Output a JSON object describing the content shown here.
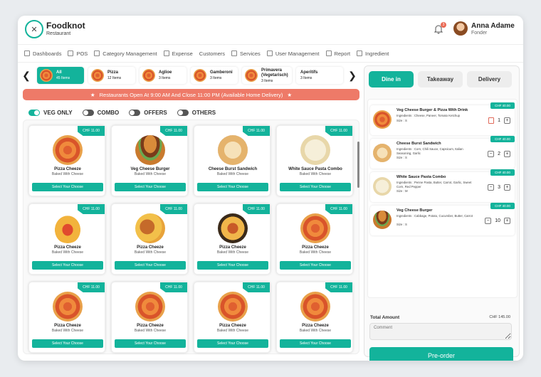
{
  "brand": {
    "name": "Foodknot",
    "sub": "Restaurant"
  },
  "header": {
    "notifications": "3",
    "user_name": "Anna Adame",
    "user_role": "Fonder"
  },
  "nav": [
    "Dashboards",
    "POS",
    "Category Management",
    "Expense",
    "Customers",
    "Services",
    "User Management",
    "Report",
    "Ingredient"
  ],
  "categories": [
    {
      "name": "All",
      "count": "45 Items"
    },
    {
      "name": "Pizza",
      "count": "12 Items"
    },
    {
      "name": "Aglioe",
      "count": "3 Items"
    },
    {
      "name": "Gamberoni",
      "count": "3 Items"
    },
    {
      "name": "Primavera (Vegetarisch)",
      "count": "3 Items"
    },
    {
      "name": "Aperitifs",
      "count": "3 Items"
    }
  ],
  "banner": "Restaurants Open At 9:00 AM And Close 11:00 PM (Available Home Delivery)",
  "filters": [
    "VEG ONLY",
    "COMBO",
    "OFFERS",
    "OTHERS"
  ],
  "products": [
    {
      "name": "Pizza Cheeze",
      "desc": "Baked With Cheese",
      "price": "CHF 11.00",
      "button": "Select Your Choose",
      "img": "pizza"
    },
    {
      "name": "Veg Cheese Burger",
      "desc": "Baked With Cheese",
      "price": "CHF 11.00",
      "button": "Select Your Choose",
      "img": "burger"
    },
    {
      "name": "Cheese Burst Sandwich",
      "desc": "Baked With Cheese",
      "price": "CHF 11.00",
      "button": "Select Your Choose",
      "img": "sandwich"
    },
    {
      "name": "White Sauce Pasta Combo",
      "desc": "Baked With Cheese",
      "price": "CHF 11.00",
      "button": "Select Your Choose",
      "img": "pasta"
    },
    {
      "name": "Pizza Cheeze",
      "desc": "Baked With Cheese",
      "price": "CHF 11.00",
      "button": "Select Your Choose",
      "img": "taco"
    },
    {
      "name": "Pizza Cheeze",
      "desc": "Baked With Cheese",
      "price": "CHF 11.00",
      "button": "Select Your Choose",
      "img": "fries"
    },
    {
      "name": "Pizza Cheeze",
      "desc": "Baked With Cheese",
      "price": "CHF 11.00",
      "button": "Select Your Choose",
      "img": "platter"
    },
    {
      "name": "Pizza Cheeze",
      "desc": "Baked With Cheese",
      "price": "CHF 11.00",
      "button": "Select Your Choose",
      "img": "pizza"
    },
    {
      "name": "Pizza Cheeze",
      "desc": "Baked With Cheese",
      "price": "CHF 11.00",
      "button": "Select Your Choose",
      "img": "pizza"
    },
    {
      "name": "Pizza Cheeze",
      "desc": "Baked With Cheese",
      "price": "CHF 11.00",
      "button": "Select Your Choose",
      "img": "pizza"
    },
    {
      "name": "Pizza Cheeze",
      "desc": "Baked With Cheese",
      "price": "CHF 11.00",
      "button": "Select Your Choose",
      "img": "pizza"
    },
    {
      "name": "Pizza Cheeze",
      "desc": "Baked With Cheese",
      "price": "CHF 11.00",
      "button": "Select Your Choose",
      "img": "pizza"
    }
  ],
  "order_tabs": [
    "Dine in",
    "Takeaway",
    "Delivery"
  ],
  "cart": [
    {
      "name": "Veg Cheese Burger & Pizza With Drink",
      "ingredients": "Ingredients : Cheese, Paneer, Tomato Ketchup",
      "size": "Size : S",
      "price": "CHF 40.00",
      "qty": "1",
      "img": "pizza"
    },
    {
      "name": "Cheese Burst Sandwich",
      "ingredients": "Ingredients : Corn, Chili Sauce, Capsicum, Italian Seasoning, Garlic",
      "size": "Size : S",
      "price": "CHF 40.00",
      "qty": "2",
      "img": "sandwich"
    },
    {
      "name": "White Sauce Pasta Combo",
      "ingredients": "Ingredients : Penne Pasta, Butter, Carrot, Garlic, Sweet Corn, Red Pepper",
      "size": "Size : M",
      "price": "CHF 40.00",
      "qty": "3",
      "img": "pasta"
    },
    {
      "name": "Veg Cheese Burger",
      "ingredients": "Ingredients : Cabbage, Potato, Cucumber, Butter, Carrot",
      "size": "Size : S",
      "price": "CHF 40.00",
      "qty": "10",
      "img": "burger"
    }
  ],
  "summary": {
    "total_label": "Total Amount",
    "total_value": "CHF 145.00",
    "comment_placeholder": "Comment",
    "preorder": "Pre-order"
  },
  "colors": {
    "accent": "#13b39b",
    "banner": "#ee7a68"
  }
}
